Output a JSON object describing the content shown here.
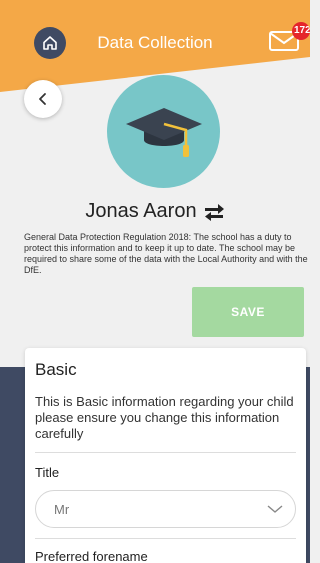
{
  "header": {
    "title": "Data Collection",
    "notification_count": "172",
    "accent_color": "#f4a847",
    "home_icon": "home-icon",
    "mail_icon": "mail-icon"
  },
  "profile": {
    "avatar_icon": "graduation-cap-icon",
    "name": "Jonas Aaron",
    "swap_icon": "swap-arrows-icon"
  },
  "notice": {
    "text": "General Data Protection Regulation 2018: The school has a duty to protect this information and to keep it up to date. The school may be required to share some of the data with the Local Authority and with the DfE."
  },
  "actions": {
    "save_label": "SAVE",
    "save_color": "#a4d9a0",
    "back_icon": "chevron-left-icon"
  },
  "form": {
    "section_title": "Basic",
    "section_description": "This is Basic information regarding your child please ensure you change this information carefully",
    "fields": [
      {
        "label": "Title",
        "value": "Mr"
      },
      {
        "label": "Preferred forename"
      }
    ]
  }
}
